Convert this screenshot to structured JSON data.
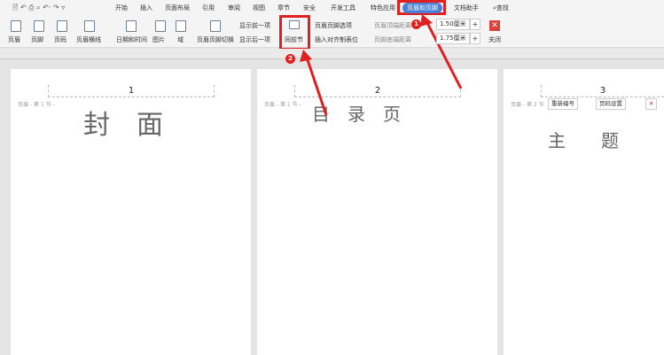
{
  "tabs": [
    "开始",
    "插入",
    "页面布局",
    "引用",
    "审阅",
    "视图",
    "章节",
    "安全",
    "开发工具",
    "特色应用",
    "页眉和页脚",
    "文档助手"
  ],
  "search": "查找",
  "ribbon": {
    "header": "页眉",
    "footer": "页脚",
    "page_num": "页码",
    "header_line": "页眉横线",
    "datetime": "日期和时间",
    "picture": "图片",
    "field": "域",
    "switch": "页眉页脚切换",
    "show_prev": "显示前一项",
    "show_next": "显示后一项",
    "same_prev": "同前节",
    "hf_options": "页眉页脚选项",
    "insert_align": "插入对齐制表位",
    "header_top_label": "页眉顶端距离",
    "footer_bottom_label": "页脚底端距离",
    "header_top_value": "1.50厘米",
    "footer_bottom_value": "1.75厘米",
    "close": "关闭"
  },
  "badges": [
    "1",
    "2"
  ],
  "pages": [
    {
      "number": "1",
      "header_label": "页眉 - 第 1 节 -",
      "title": "封　面"
    },
    {
      "number": "2",
      "header_label": "页眉 - 第 1 节 -",
      "title": "目　录　页"
    },
    {
      "number": "3",
      "header_label": "页眉 - 第 2 节",
      "title": "主　　题",
      "renumber": "重新编号",
      "page_setup": "页码设置"
    }
  ],
  "colors": {
    "accent": "#e02020",
    "active_tab": "#4a7fd4"
  }
}
